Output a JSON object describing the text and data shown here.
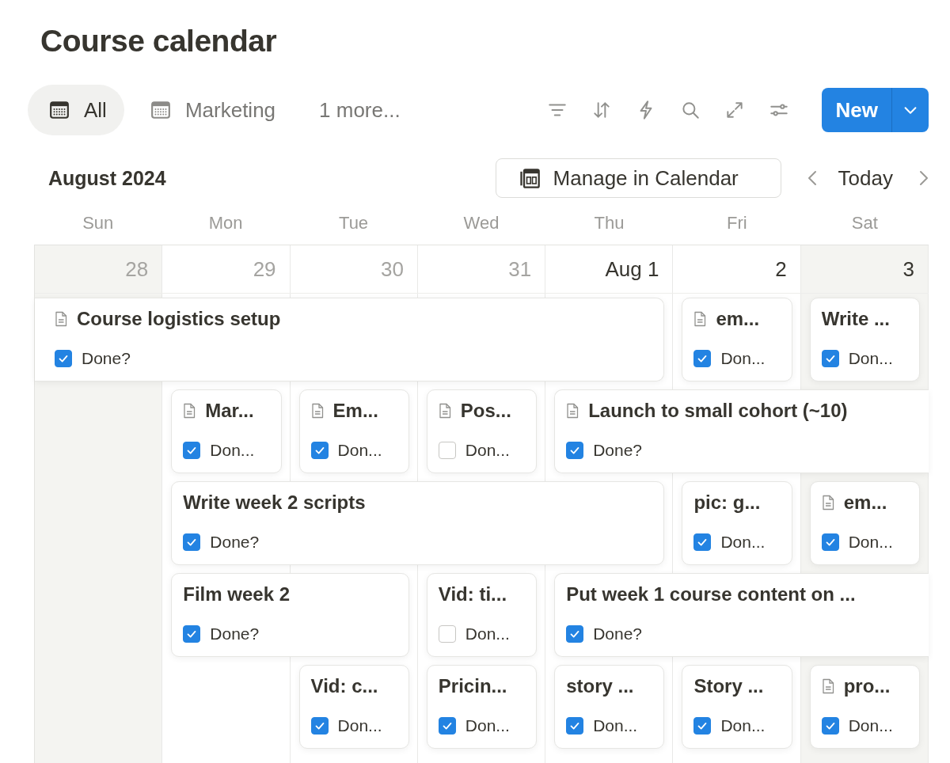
{
  "title": "Course calendar",
  "tabs": [
    {
      "kind": "view",
      "label": "All",
      "selected": true
    },
    {
      "kind": "view",
      "label": "Marketing",
      "selected": false
    },
    {
      "kind": "more",
      "label": "1 more...",
      "selected": false
    }
  ],
  "new_button": {
    "label": "New"
  },
  "month": "August 2024",
  "manage_button": {
    "label": "Manage in Calendar"
  },
  "today_button": {
    "label": "Today"
  },
  "weekdays": [
    "Sun",
    "Mon",
    "Tue",
    "Wed",
    "Thu",
    "Fri",
    "Sat"
  ],
  "days": [
    {
      "label": "28",
      "weekend": true,
      "other_month": true
    },
    {
      "label": "29",
      "weekend": false,
      "other_month": true
    },
    {
      "label": "30",
      "weekend": false,
      "other_month": true
    },
    {
      "label": "31",
      "weekend": false,
      "other_month": true
    },
    {
      "label": "Aug 1",
      "weekend": false,
      "other_month": false
    },
    {
      "label": "2",
      "weekend": false,
      "other_month": false
    },
    {
      "label": "3",
      "weekend": true,
      "other_month": false
    }
  ],
  "event_rows": [
    [
      {
        "title": "Course logistics setup",
        "page_icon": true,
        "cut_left": true,
        "cut_right": false,
        "done": true,
        "done_label": "Done?"
      },
      {
        "title": "em...",
        "page_icon": true,
        "cut_left": false,
        "cut_right": false,
        "done": true,
        "done_label": "Don..."
      },
      {
        "title": "Write ...",
        "page_icon": false,
        "cut_left": false,
        "cut_right": false,
        "done": true,
        "done_label": "Don..."
      }
    ],
    [
      {
        "title": "Mar...",
        "page_icon": true,
        "cut_left": false,
        "cut_right": false,
        "done": true,
        "done_label": "Don..."
      },
      {
        "title": "Em...",
        "page_icon": true,
        "cut_left": false,
        "cut_right": false,
        "done": true,
        "done_label": "Don..."
      },
      {
        "title": "Pos...",
        "page_icon": true,
        "cut_left": false,
        "cut_right": false,
        "done": false,
        "done_label": "Don..."
      },
      {
        "title": "Launch to small cohort (~10)",
        "page_icon": true,
        "cut_left": false,
        "cut_right": true,
        "done": true,
        "done_label": "Done?"
      }
    ],
    [
      {
        "title": "Write week 2 scripts",
        "page_icon": false,
        "cut_left": false,
        "cut_right": false,
        "done": true,
        "done_label": "Done?"
      },
      {
        "title": "pic: g...",
        "page_icon": false,
        "cut_left": false,
        "cut_right": false,
        "done": true,
        "done_label": "Don..."
      },
      {
        "title": "em...",
        "page_icon": true,
        "cut_left": false,
        "cut_right": false,
        "done": true,
        "done_label": "Don..."
      }
    ],
    [
      {
        "title": "Film week 2",
        "page_icon": false,
        "cut_left": false,
        "cut_right": false,
        "done": true,
        "done_label": "Done?"
      },
      {
        "title": "Vid: ti...",
        "page_icon": false,
        "cut_left": false,
        "cut_right": false,
        "done": false,
        "done_label": "Don..."
      },
      {
        "title": "Put week 1 course content on ...",
        "page_icon": false,
        "cut_left": false,
        "cut_right": true,
        "done": true,
        "done_label": "Done?"
      }
    ],
    [
      {
        "title": "Vid: c...",
        "page_icon": false,
        "cut_left": false,
        "cut_right": false,
        "done": true,
        "done_label": "Don..."
      },
      {
        "title": "Pricin...",
        "page_icon": false,
        "cut_left": false,
        "cut_right": false,
        "done": true,
        "done_label": "Don..."
      },
      {
        "title": "story ...",
        "page_icon": false,
        "cut_left": false,
        "cut_right": false,
        "done": true,
        "done_label": "Don..."
      },
      {
        "title": "Story ...",
        "page_icon": false,
        "cut_left": false,
        "cut_right": false,
        "done": true,
        "done_label": "Don..."
      },
      {
        "title": "pro...",
        "page_icon": true,
        "cut_left": false,
        "cut_right": false,
        "done": true,
        "done_label": "Don..."
      }
    ]
  ]
}
